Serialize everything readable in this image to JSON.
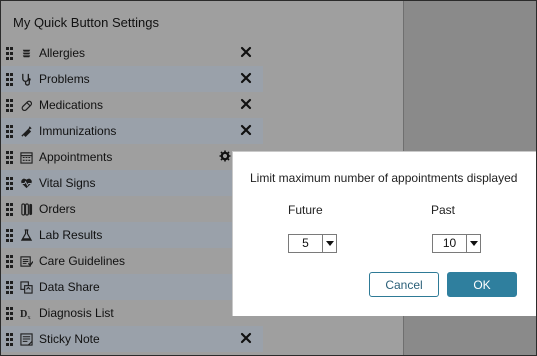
{
  "panel": {
    "title": "My Quick Button Settings"
  },
  "items": [
    {
      "label": "Allergies",
      "icon": "allergies-icon",
      "removable": true
    },
    {
      "label": "Problems",
      "icon": "stethoscope-icon",
      "removable": true
    },
    {
      "label": "Medications",
      "icon": "pill-icon",
      "removable": true
    },
    {
      "label": "Immunizations",
      "icon": "syringe-icon",
      "removable": true
    },
    {
      "label": "Appointments",
      "icon": "calendar-icon",
      "removable": false,
      "settings": true
    },
    {
      "label": "Vital Signs",
      "icon": "heart-pulse-icon",
      "removable": false
    },
    {
      "label": "Orders",
      "icon": "test-tubes-icon",
      "removable": false
    },
    {
      "label": "Lab Results",
      "icon": "flask-icon",
      "removable": false
    },
    {
      "label": "Care Guidelines",
      "icon": "care-guidelines-icon",
      "removable": false
    },
    {
      "label": "Data Share",
      "icon": "data-share-icon",
      "removable": false
    },
    {
      "label": "Diagnosis List",
      "icon": "dx-icon",
      "removable": false
    },
    {
      "label": "Sticky Note",
      "icon": "sticky-note-icon",
      "removable": true
    }
  ],
  "popup": {
    "title": "Limit maximum number of appointments displayed",
    "future_label": "Future",
    "past_label": "Past",
    "future_value": "5",
    "past_value": "10",
    "cancel_label": "Cancel",
    "ok_label": "OK"
  },
  "colors": {
    "accent": "#2f7f9e",
    "overlay": "#9f9f9f"
  }
}
